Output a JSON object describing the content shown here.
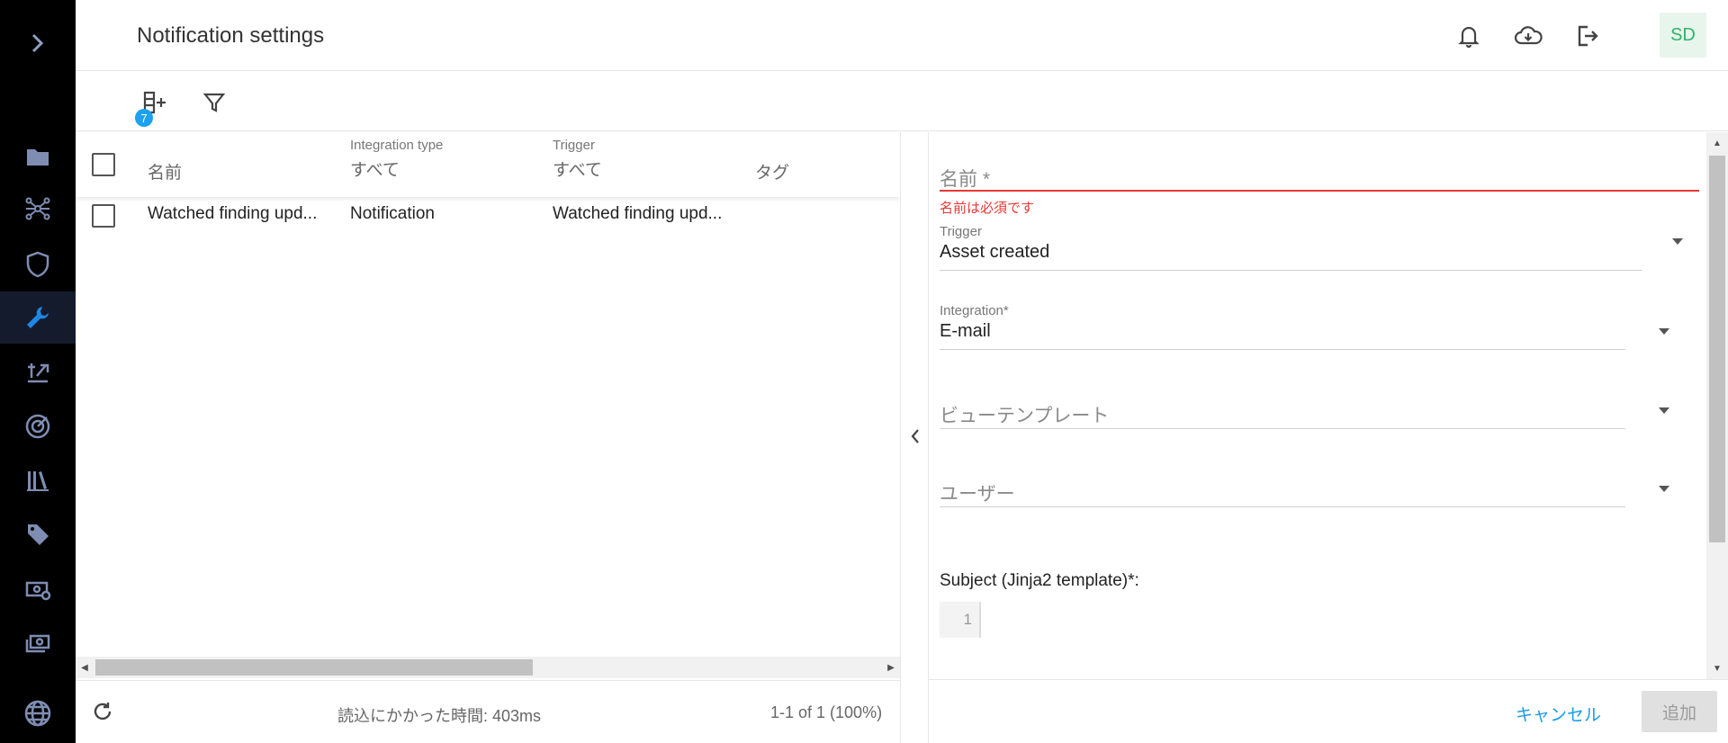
{
  "header": {
    "title": "Notification settings",
    "avatar": "SD"
  },
  "nav": {
    "icons": [
      "folder-icon",
      "network-icon",
      "shield-icon",
      "wrench-icon",
      "tools-icon",
      "radar-icon",
      "library-icon",
      "tag-icon",
      "billing-icon",
      "payments-icon",
      "globe-icon"
    ],
    "active": "wrench-icon"
  },
  "toolbar": {
    "badge_count": "7"
  },
  "table": {
    "columns": [
      {
        "label": "名前",
        "filter": ""
      },
      {
        "label": "Integration type",
        "filter": "すべて"
      },
      {
        "label": "Trigger",
        "filter": "すべて"
      },
      {
        "label": "タグ",
        "filter": ""
      }
    ],
    "rows": [
      {
        "name": "Watched finding upd...",
        "integration_type": "Notification",
        "trigger": "Watched finding upd...",
        "tags": ""
      }
    ],
    "footer": {
      "load_time": "読込にかかった時間: 403ms",
      "pagination": "1-1 of 1 (100%)"
    }
  },
  "form": {
    "name": {
      "placeholder": "名前 *",
      "error": "名前は必須です"
    },
    "trigger": {
      "label": "Trigger",
      "value": "Asset created"
    },
    "integration": {
      "label": "Integration*",
      "value": "E-mail"
    },
    "view_template": {
      "placeholder": "ビューテンプレート"
    },
    "users": {
      "placeholder": "ユーザー"
    },
    "subject": {
      "label": "Subject (Jinja2 template)*:",
      "line_number": "1"
    },
    "cancel_label": "キャンセル",
    "add_label": "追加"
  },
  "colors": {
    "accent": "#1da1f2",
    "error": "#e53935",
    "nav_bg": "#000000",
    "avatar_text": "#2fb36a"
  }
}
